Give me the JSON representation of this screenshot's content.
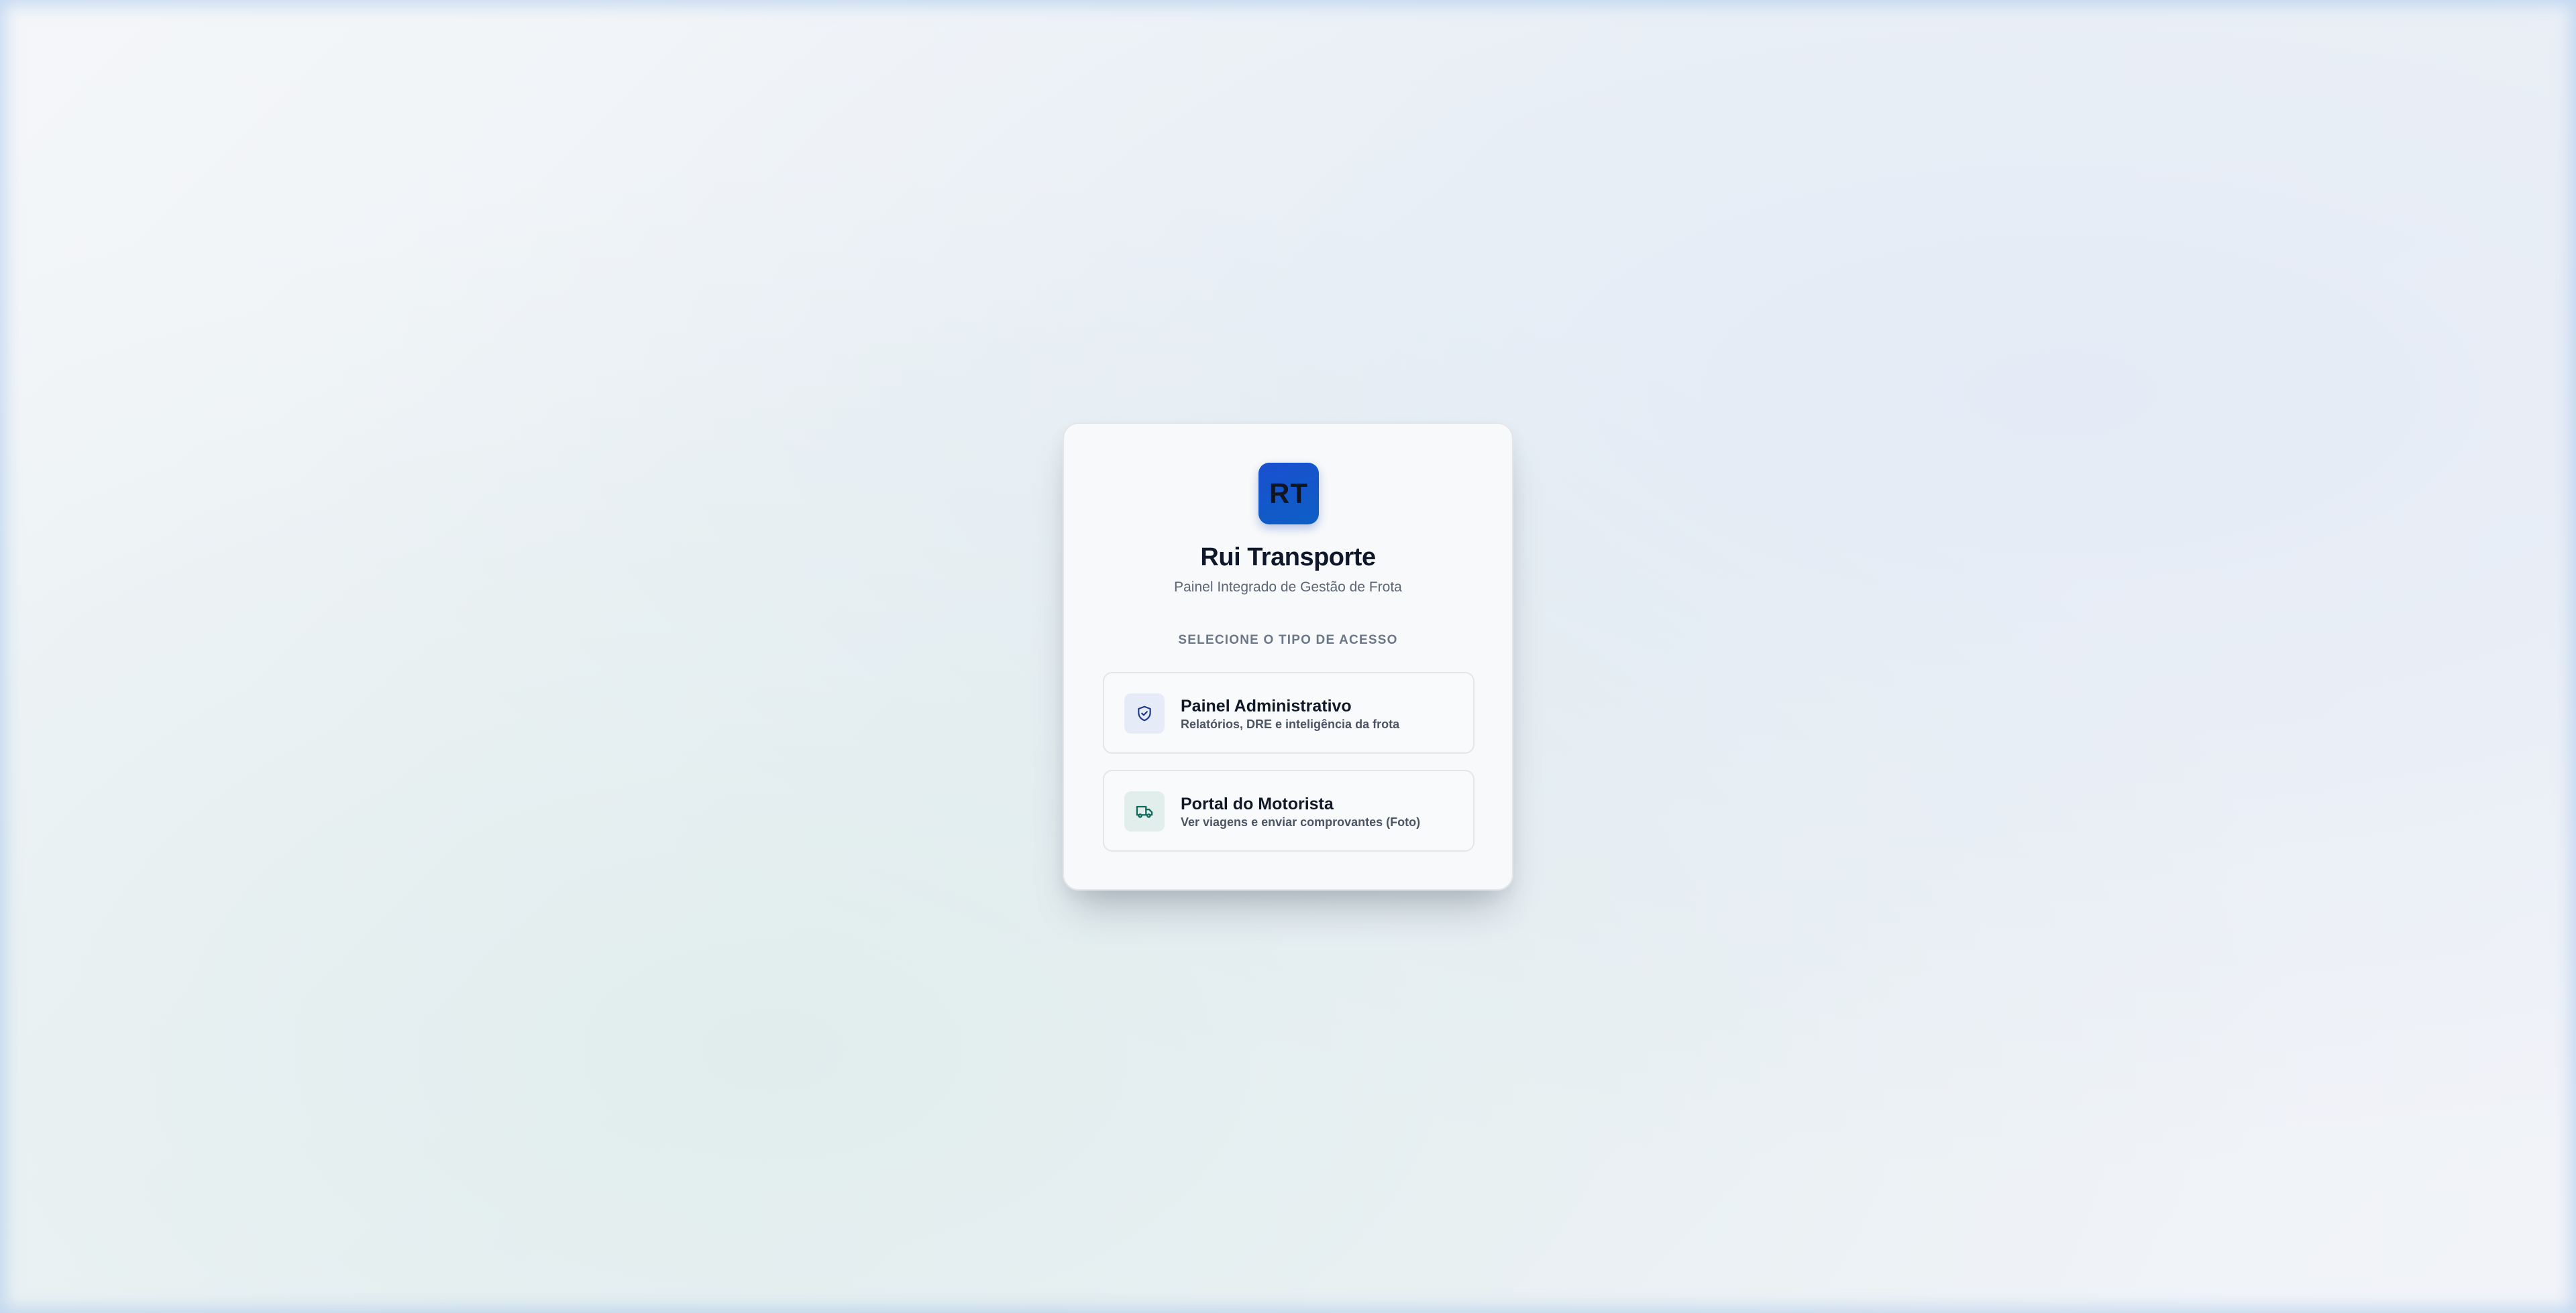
{
  "brand": {
    "logo_text": "RT",
    "title": "Rui Transporte",
    "subtitle": "Painel Integrado de Gestão de Frota"
  },
  "access": {
    "section_label": "SELECIONE O TIPO DE ACESSO",
    "options": [
      {
        "title": "Painel Administrativo",
        "description": "Relatórios, DRE e inteligência da frota",
        "icon": "shield-check-icon"
      },
      {
        "title": "Portal do Motorista",
        "description": "Ver viagens e enviar comprovantes (Foto)",
        "icon": "truck-icon"
      }
    ]
  },
  "colors": {
    "brand_blue": "#1a4fd0",
    "admin_icon": "#1e3a8a",
    "driver_icon": "#0f6b5c"
  }
}
